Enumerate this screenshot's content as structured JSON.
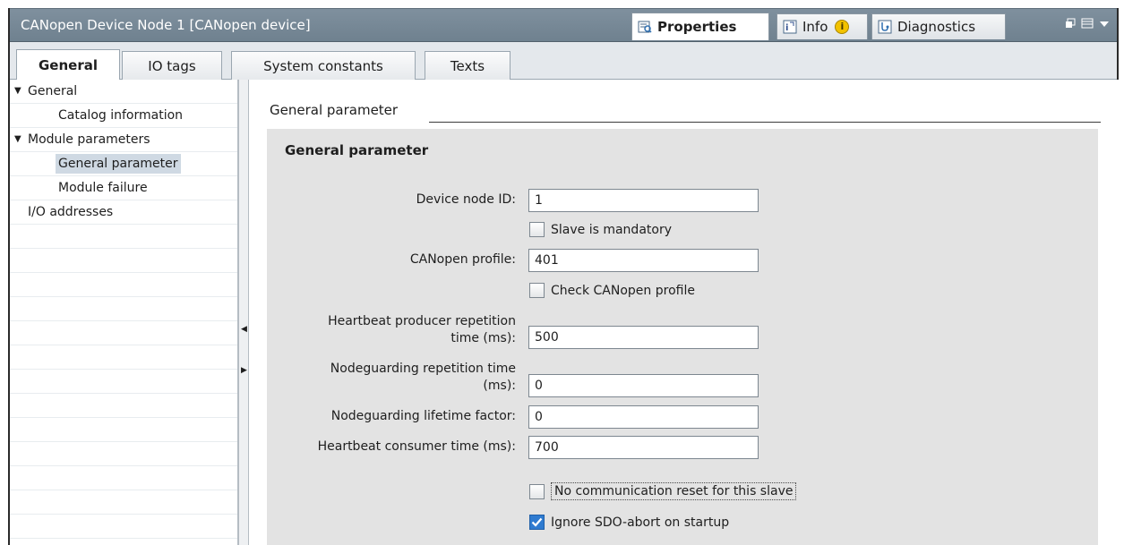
{
  "window": {
    "title": "CANopen Device Node 1 [CANopen device]",
    "tabs": [
      {
        "label": "Properties",
        "icon": "properties-icon",
        "active": true
      },
      {
        "label": "Info",
        "icon": "info-icon",
        "active": false
      },
      {
        "label": "Diagnostics",
        "icon": "diagnostics-icon",
        "active": false
      }
    ]
  },
  "subtabs": [
    {
      "label": "General",
      "active": true
    },
    {
      "label": "IO tags",
      "active": false
    },
    {
      "label": "System constants",
      "active": false
    },
    {
      "label": "Texts",
      "active": false
    }
  ],
  "tree": [
    {
      "label": "General",
      "expanded": true,
      "level": 0
    },
    {
      "label": "Catalog information",
      "level": 1
    },
    {
      "label": "Module parameters",
      "expanded": true,
      "level": 0
    },
    {
      "label": "General parameter",
      "level": 1,
      "selected": true
    },
    {
      "label": "Module failure",
      "level": 1
    },
    {
      "label": "I/O addresses",
      "level": 0
    }
  ],
  "main": {
    "section_title": "General parameter",
    "panel_title": "General parameter",
    "fields": {
      "device_node_id": {
        "label": "Device node ID:",
        "value": "1"
      },
      "slave_mandatory": {
        "label": "Slave is mandatory",
        "checked": false
      },
      "canopen_profile": {
        "label": "CANopen profile:",
        "value": "401"
      },
      "check_profile": {
        "label": "Check CANopen profile",
        "checked": false
      },
      "heartbeat_producer": {
        "label_line1": "Heartbeat producer repetition",
        "label_line2": "time (ms):",
        "value": "500"
      },
      "nodeguarding_time": {
        "label_line1": "Nodeguarding repetition time",
        "label_line2": "(ms):",
        "value": "0"
      },
      "nodeguarding_lifetime": {
        "label": "Nodeguarding lifetime factor:",
        "value": "0"
      },
      "heartbeat_consumer": {
        "label": "Heartbeat consumer time (ms):",
        "value": "700"
      },
      "no_comm_reset": {
        "label": "No communication reset for this slave",
        "checked": false
      },
      "ignore_sdo_abort": {
        "label": "Ignore SDO-abort on startup",
        "checked": true
      }
    }
  },
  "colors": {
    "titlebar": "#7f909e",
    "panel": "#e3e3e3",
    "selection": "#cfd9e3",
    "checkbox_checked": "#2f7bd0"
  }
}
